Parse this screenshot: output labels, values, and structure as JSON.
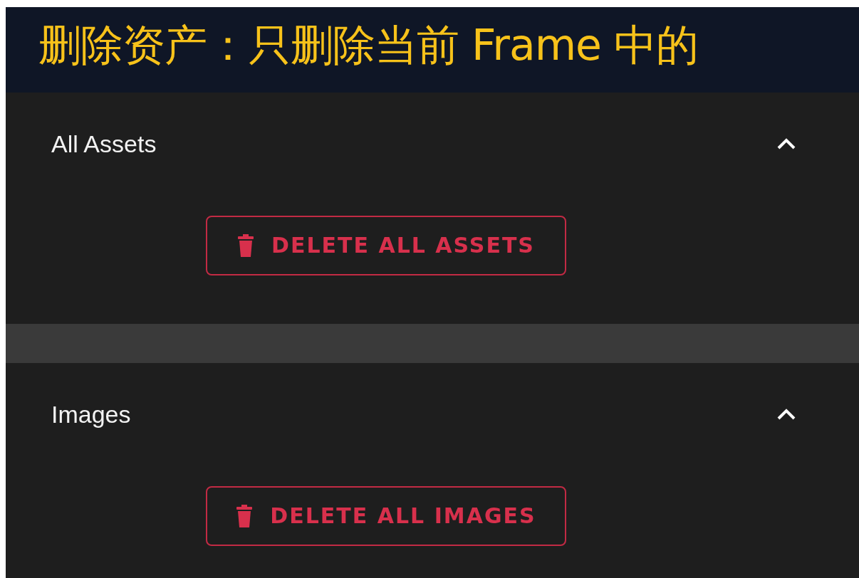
{
  "banner": {
    "title": "删除资产：只删除当前 Frame 中的"
  },
  "sections": [
    {
      "title": "All Assets",
      "expanded": true,
      "button": "DELETE ALL ASSETS"
    },
    {
      "title": "Images",
      "expanded": true,
      "button": "DELETE ALL IMAGES"
    }
  ]
}
